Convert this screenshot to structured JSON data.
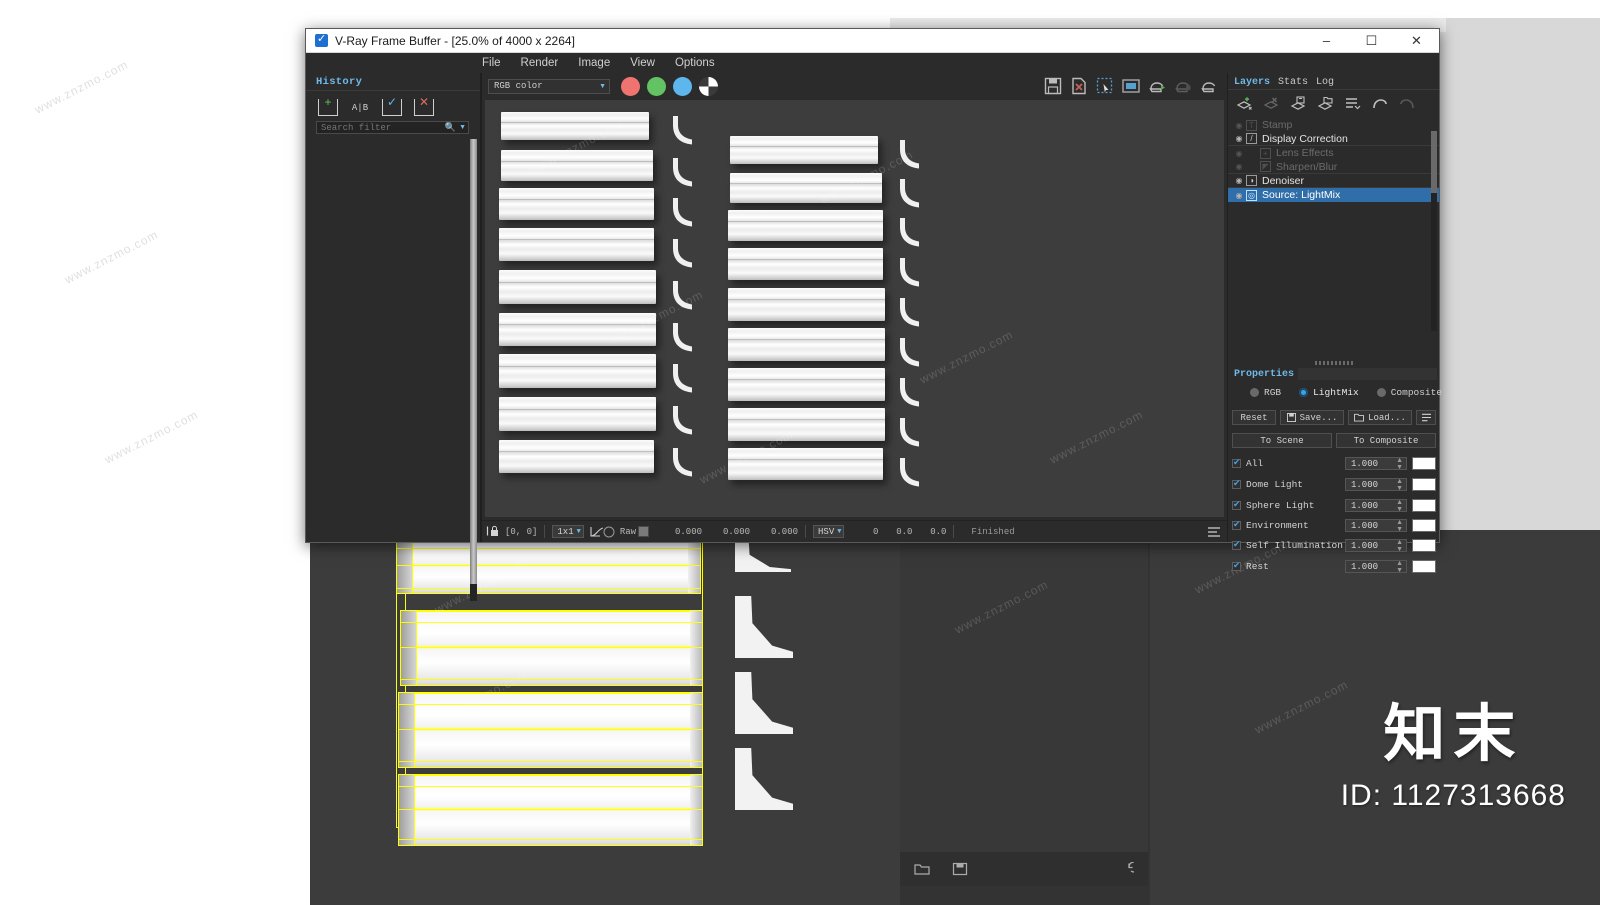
{
  "window": {
    "title": "V-Ray Frame Buffer - [25.0% of 4000 x 2264]",
    "app_icon": "vray-logo-icon",
    "minimize": "–",
    "maximize": "☐",
    "close": "✕"
  },
  "menu": {
    "items": [
      "File",
      "Render",
      "Image",
      "View",
      "Options"
    ]
  },
  "history": {
    "tab_label": "History",
    "tools": [
      {
        "name": "add-history-icon",
        "glyph": "+"
      },
      {
        "name": "compare-history-icon",
        "glyph": "A|B"
      },
      {
        "name": "accept-history-icon",
        "glyph": "✓"
      },
      {
        "name": "delete-history-icon",
        "glyph": "✕"
      }
    ],
    "search_placeholder": "Search filter",
    "search_value": "",
    "search_icon": "magnifier-icon",
    "filter_caret": "chevron-down-icon"
  },
  "image_toolbar": {
    "channel_select": {
      "value": "RGB color",
      "caret": "chevron-down-icon"
    },
    "channel_chips": [
      {
        "name": "red-channel-toggle",
        "color": "#ef7470"
      },
      {
        "name": "green-channel-toggle",
        "color": "#63c362"
      },
      {
        "name": "blue-channel-toggle",
        "color": "#5db7ed"
      },
      {
        "name": "alpha-channel-toggle",
        "color": "#ffffff"
      }
    ],
    "right_icons": [
      "save-image-icon",
      "clear-image-icon",
      "region-render-icon",
      "fit-to-window-icon",
      "start-render-icon",
      "stop-render-icon",
      "render-last-icon"
    ]
  },
  "statusbar": {
    "lock_icon": "pixel-lock-icon",
    "coords": "[0,  0]",
    "sample_size": "1x1",
    "curve_icon": "color-curve-icon",
    "raw_label": "Raw",
    "raw_swatch": "#7a7a7a",
    "raw_values": [
      "0.000",
      "0.000",
      "0.000"
    ],
    "color_mode": "HSV",
    "hsv_values": [
      "0",
      "0.0",
      "0.0"
    ],
    "render_state": "Finished",
    "end_icon": "list-options-icon"
  },
  "right_panel": {
    "tabs": [
      {
        "label": "Layers",
        "active": true
      },
      {
        "label": "Stats",
        "active": false
      },
      {
        "label": "Log",
        "active": false
      }
    ],
    "layer_tools": [
      "add-layer-icon",
      "delete-layer-icon",
      "duplicate-layer-icon",
      "load-layer-icon",
      "layer-list-icon",
      "undo-icon",
      "redo-icon"
    ],
    "layers": [
      {
        "name": "Stamp",
        "visible": false,
        "enabled": false,
        "selected": false,
        "icon_glyph": "T"
      },
      {
        "name": "Display Correction",
        "visible": true,
        "enabled": true,
        "selected": false,
        "icon_glyph": "/"
      },
      {
        "name": "Lens Effects",
        "visible": false,
        "enabled": false,
        "selected": false,
        "icon_glyph": "+"
      },
      {
        "name": "Sharpen/Blur",
        "visible": false,
        "enabled": false,
        "selected": false,
        "icon_glyph": "◤"
      },
      {
        "name": "Denoiser",
        "visible": true,
        "enabled": true,
        "selected": false,
        "icon_glyph": "◑"
      },
      {
        "name": "Source: LightMix",
        "visible": true,
        "enabled": true,
        "selected": true,
        "icon_glyph": "◎"
      }
    ],
    "properties": {
      "header": "Properties",
      "modes": [
        {
          "label": "RGB",
          "selected": false
        },
        {
          "label": "LightMix",
          "selected": true
        },
        {
          "label": "Composite",
          "selected": false
        }
      ],
      "buttons": [
        {
          "label": "Reset",
          "icon": ""
        },
        {
          "label": "Save...",
          "icon": "floppy-icon"
        },
        {
          "label": "Load...",
          "icon": "folder-icon"
        },
        {
          "label": "",
          "icon": "menu-list-icon"
        }
      ],
      "transfer_buttons": [
        {
          "label": "To Scene"
        },
        {
          "label": "To Composite"
        }
      ],
      "lightmix_rows": [
        {
          "label": "All",
          "checked": true,
          "value": "1.000",
          "color": "#ffffff"
        },
        {
          "label": "Dome Light",
          "checked": true,
          "value": "1.000",
          "color": "#ffffff"
        },
        {
          "label": "Sphere Light",
          "checked": true,
          "value": "1.000",
          "color": "#ffffff"
        },
        {
          "label": "Environment",
          "checked": true,
          "value": "1.000",
          "color": "#ffffff"
        },
        {
          "label": "Self Illumination",
          "checked": true,
          "value": "1.000",
          "color": "#ffffff"
        },
        {
          "label": "Rest",
          "checked": true,
          "value": "1.000",
          "color": "#ffffff"
        }
      ]
    }
  },
  "background": {
    "bottom_toolbar_icons": [
      "open-file-icon",
      "save-file-icon",
      "reset-icon"
    ]
  },
  "watermark": {
    "brand": "知末",
    "id_text": "ID: 1127313668",
    "tile_text": "www.znzmo.com"
  },
  "render_scene": {
    "description": "3D render of crown molding profiles arranged in two columns with cross-section profiles",
    "left_column_count": 9,
    "right_column_count": 9,
    "background_color": "#3d3d3d",
    "material_color": "#f2f2f2"
  }
}
